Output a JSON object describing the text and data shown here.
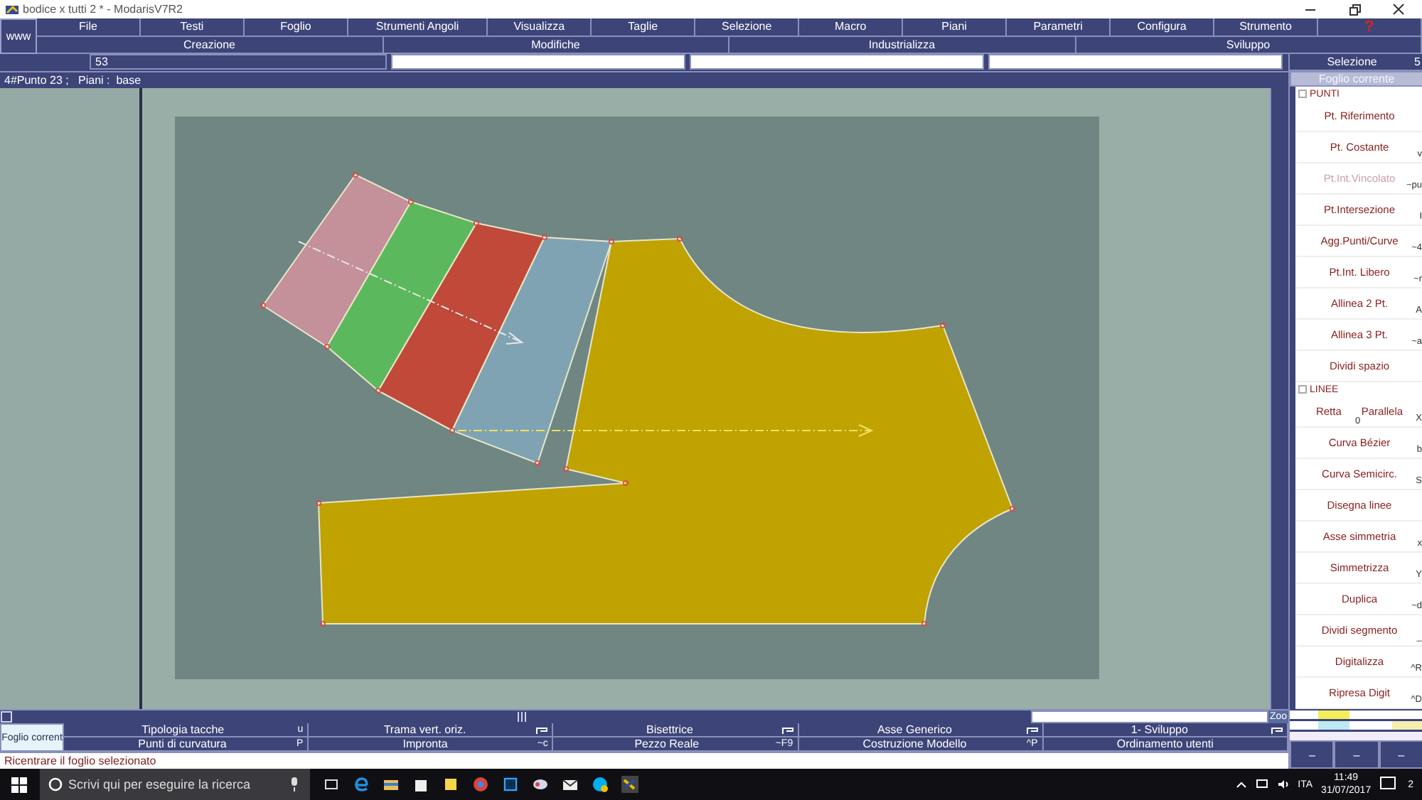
{
  "window": {
    "title": "bodice x tutti 2 * - ModarisV7R2"
  },
  "menu": {
    "corner": "www",
    "items": [
      {
        "label": "File",
        "kind": "menu"
      },
      {
        "label": "Testi",
        "kind": "menu"
      },
      {
        "label": "Foglio",
        "kind": "menu"
      },
      {
        "label": "Strumenti Angoli",
        "kind": "menu"
      },
      {
        "label": "Visualizza",
        "kind": "menu"
      },
      {
        "label": "Taglie",
        "kind": "menu"
      },
      {
        "label": "Selezione",
        "kind": "menu"
      },
      {
        "label": "Macro",
        "kind": "menu"
      },
      {
        "label": "Piani",
        "kind": "menu"
      },
      {
        "label": "Parametri",
        "kind": "menu"
      },
      {
        "label": "Configura",
        "kind": "menu"
      },
      {
        "label": "Strumento",
        "kind": "menu"
      },
      {
        "label": "?",
        "kind": "help"
      }
    ],
    "groups": [
      "Creazione",
      "Modifiche",
      "Industrializza",
      "Sviluppo"
    ]
  },
  "point_field": {
    "value": "53"
  },
  "info_line": "4#Punto 23 ;   Piani :  base",
  "canvas": {
    "pieces": [
      {
        "color": "#c4909a"
      },
      {
        "color": "#5cb85c"
      },
      {
        "color": "#c0493a"
      },
      {
        "color": "#7fa3b3"
      },
      {
        "color": "#c0a200"
      }
    ],
    "zoom_label": "Zoo"
  },
  "side_panel": {
    "title": "Selezione",
    "count": "5",
    "sheet_button": "Foglio corrente",
    "sections": [
      {
        "label": "PUNTI",
        "checked": false,
        "items": [
          {
            "kind": "single",
            "label": "Pt. Riferimento",
            "disabled": false
          },
          {
            "kind": "single",
            "label": "Pt. Costante",
            "shortcut": "v",
            "disabled": false
          },
          {
            "kind": "single",
            "label": "Pt.Int.Vincolato",
            "shortcut": "~pu",
            "disabled": true
          },
          {
            "kind": "single",
            "label": "Pt.Intersezione",
            "shortcut": "I",
            "disabled": false
          },
          {
            "kind": "single",
            "label": "Agg.Punti/Curve",
            "shortcut": "~4",
            "disabled": false
          },
          {
            "kind": "single",
            "label": "Pt.Int. Libero",
            "shortcut": "~r",
            "disabled": false
          },
          {
            "kind": "single",
            "label": "Allinea 2 Pt.",
            "shortcut": "A",
            "disabled": false
          },
          {
            "kind": "single",
            "label": "Allinea 3 Pt.",
            "shortcut": "~a",
            "disabled": false
          },
          {
            "kind": "single",
            "label": "Dividi spazio",
            "disabled": false
          }
        ]
      },
      {
        "label": "LINEE",
        "checked": false,
        "items": [
          {
            "kind": "pair",
            "label": "Retta",
            "label_2": "Parallela",
            "key": "0",
            "shortcut": "X",
            "disabled": false
          },
          {
            "kind": "single",
            "label": "Curva Bézier",
            "shortcut": "b",
            "disabled": false
          },
          {
            "kind": "single",
            "label": "Curva Semicirc.",
            "shortcut": "S",
            "disabled": false
          },
          {
            "kind": "single",
            "label": "Disegna linee",
            "disabled": false
          },
          {
            "kind": "single",
            "label": "Asse simmetria",
            "shortcut": "x",
            "disabled": false
          },
          {
            "kind": "single",
            "label": "Simmetrizza",
            "shortcut": "Y",
            "disabled": false
          },
          {
            "kind": "single",
            "label": "Duplica",
            "shortcut": "~d",
            "disabled": false
          },
          {
            "kind": "single",
            "label": "Dividi segmento",
            "shortcut": "_",
            "disabled": false
          },
          {
            "kind": "single",
            "label": "Digitalizza",
            "shortcut": "^R",
            "disabled": false
          },
          {
            "kind": "single",
            "label": "Ripresa Digit",
            "shortcut": "^D",
            "disabled": false
          }
        ]
      }
    ],
    "mini_buttons": [
      "–",
      "–",
      "–"
    ]
  },
  "bottom_toolbar": {
    "sheet_button": "Foglio corrent",
    "rows": [
      [
        {
          "label": "Tipologia tacche",
          "kind": "key",
          "shortcut": "u"
        },
        {
          "label": "Trama vert. oriz.",
          "kind": "icon"
        },
        {
          "label": "Bisettrice",
          "kind": "icon"
        },
        {
          "label": "Asse Generico",
          "kind": "icon"
        },
        {
          "label": "1- Sviluppo",
          "kind": "icon"
        }
      ],
      [
        {
          "label": "Punti di curvatura",
          "kind": "key",
          "shortcut": "P"
        },
        {
          "label": "Impronta",
          "kind": "key",
          "shortcut": "~c"
        },
        {
          "label": "Pezzo Reale",
          "kind": "key",
          "shortcut": "~F9"
        },
        {
          "label": "Costruzione Modello",
          "kind": "key",
          "shortcut": "^P"
        },
        {
          "label": "Ordinamento utenti",
          "kind": "plain"
        }
      ]
    ]
  },
  "status_bar": "Ricentrare il foglio selezionato",
  "taskbar": {
    "search": {
      "placeholder": "Scrivi qui per eseguire la ricerca"
    },
    "language": "ITA",
    "time": "11:49",
    "date": "31/07/2017",
    "notifications": "2"
  }
}
